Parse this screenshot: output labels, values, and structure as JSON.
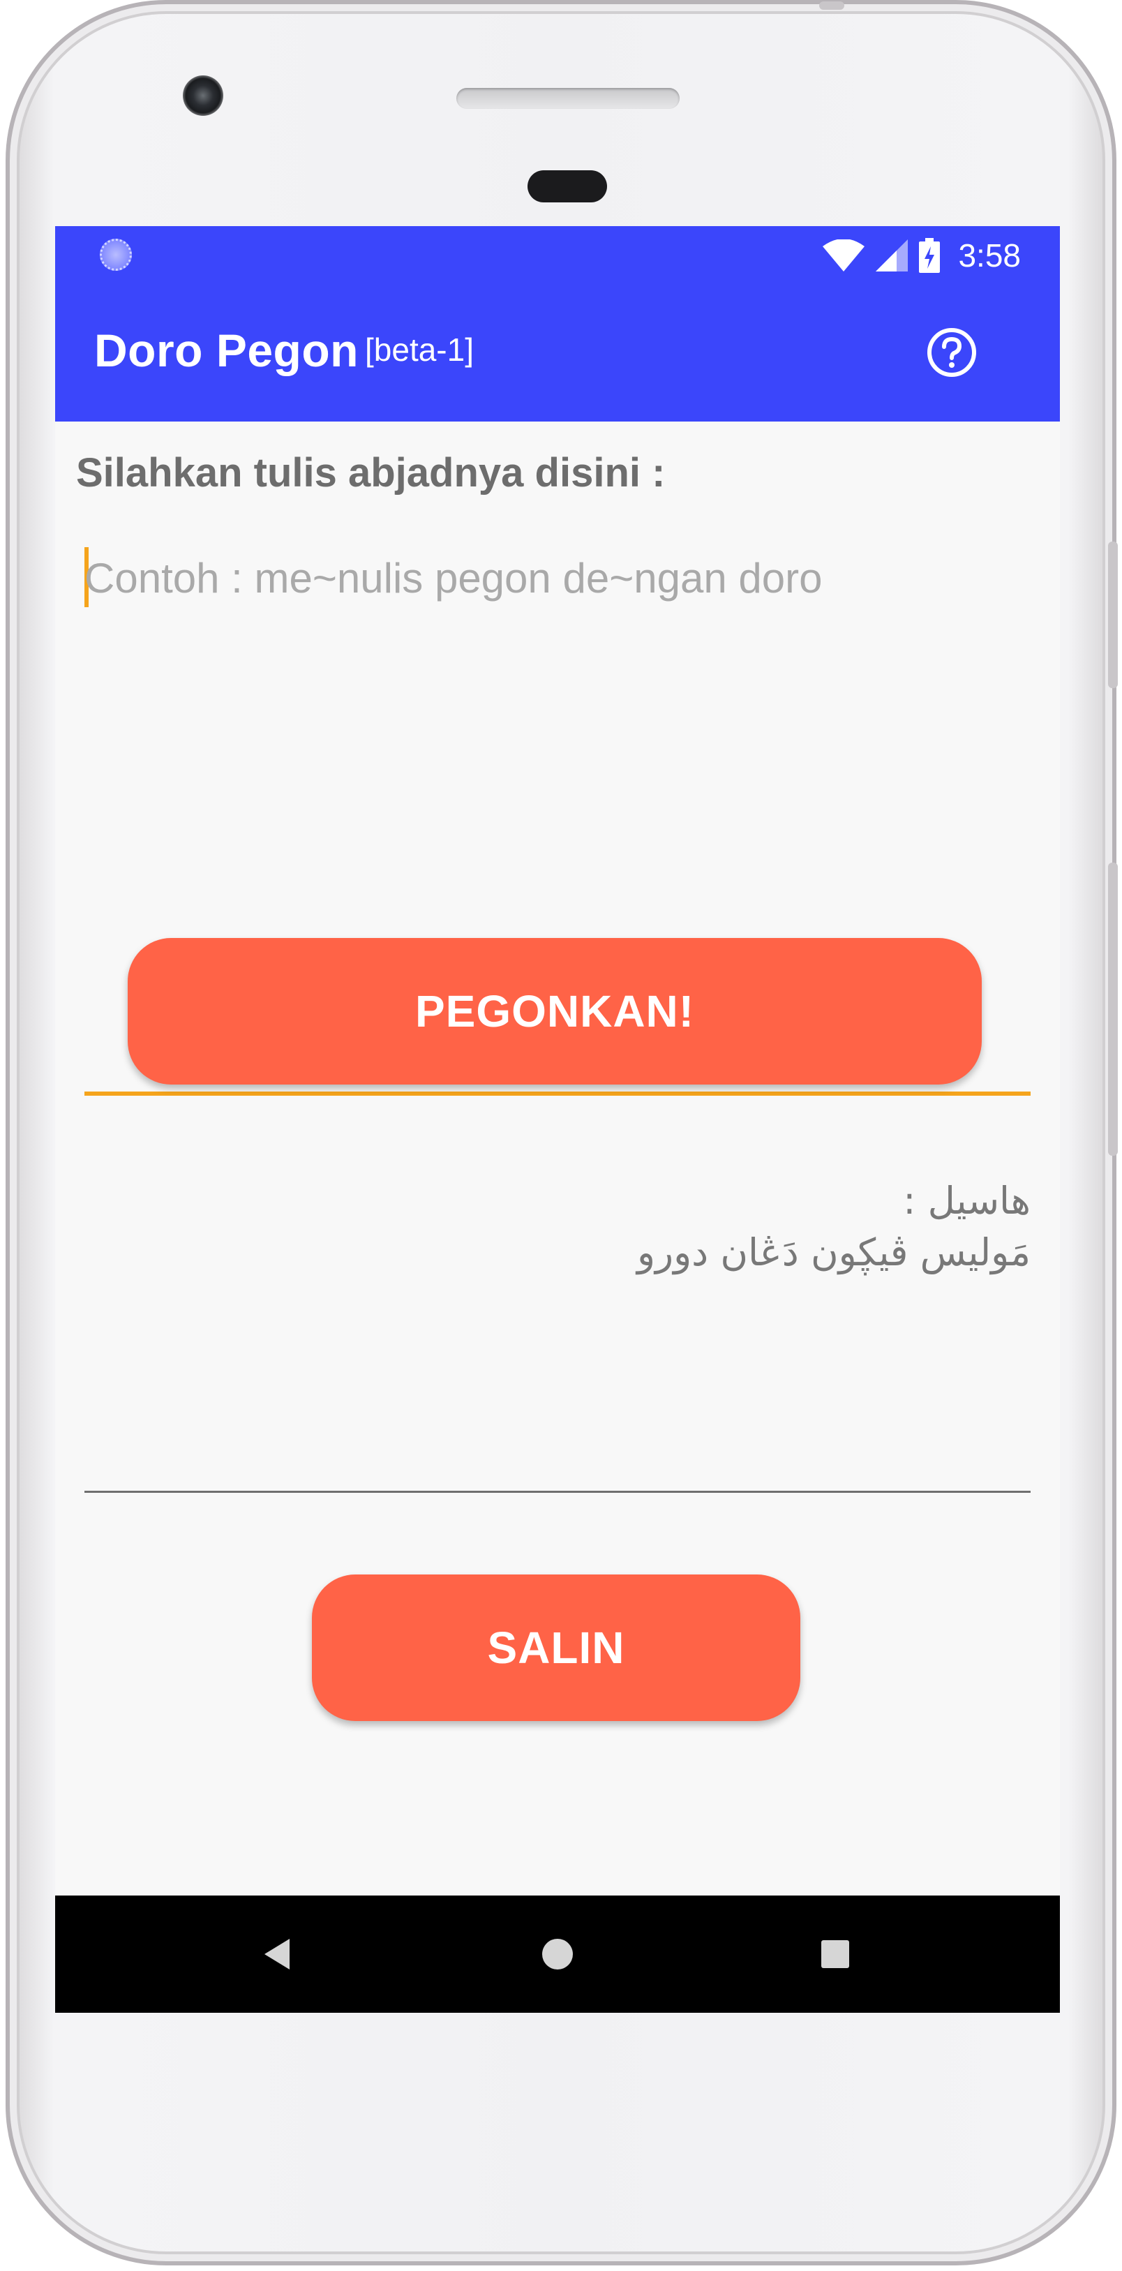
{
  "status_bar": {
    "time": "3:58",
    "icons": [
      "wifi-icon",
      "cellular-signal-icon",
      "battery-charging-icon"
    ]
  },
  "app_bar": {
    "title": "Doro Pegon",
    "subtitle": "[beta-1]",
    "help_icon": "help-circle-icon"
  },
  "form": {
    "label": "Silahkan tulis abjadnya disini :",
    "input_placeholder": "Contoh : me~nulis pegon de~ngan doro",
    "input_value": "",
    "convert_button": "PEGONKAN!",
    "output_text": "هاسيل :\nمَوليس ڤيڮون دَڠان دورو",
    "copy_button": "SALIN"
  },
  "nav_bar": {
    "back": "back-triangle-icon",
    "home": "home-circle-icon",
    "recents": "recents-square-icon"
  },
  "colors": {
    "primary": "#3b46fb",
    "accent_button": "#ff6347",
    "input_accent": "#f5a41c",
    "background": "#f8f8f8"
  }
}
